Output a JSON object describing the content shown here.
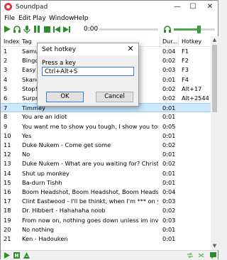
{
  "window": {
    "title": "Soundpad",
    "minimize_glyph": "—",
    "maximize_glyph": "☐",
    "close_glyph": "✕"
  },
  "menu": [
    "File",
    "Edit",
    "Play",
    "Window",
    "Help"
  ],
  "toolbar": {
    "time": "0:00",
    "volume_fraction": 0.6,
    "accent_color": "#2e8b2e"
  },
  "table": {
    "columns": [
      "Index",
      "Tag",
      "Dur...",
      "Hotkey"
    ],
    "rows": [
      {
        "index": "1",
        "tag": "Samu",
        "dur": "0:04",
        "hotkey": "F1"
      },
      {
        "index": "2",
        "tag": "Bingo",
        "dur": "0:02",
        "hotkey": "F2"
      },
      {
        "index": "3",
        "tag": "Easy s",
        "dur": "0:03",
        "hotkey": "F3"
      },
      {
        "index": "4",
        "tag": "Skand",
        "dur": "0:01",
        "hotkey": "F4"
      },
      {
        "index": "5",
        "tag": "Stop!",
        "dur": "0:02",
        "hotkey": "Alt+17"
      },
      {
        "index": "6",
        "tag": "Surpr",
        "dur": "0:02",
        "hotkey": "Alt+2544"
      },
      {
        "index": "7",
        "tag": "Timmey",
        "dur": "0:01",
        "hotkey": ""
      },
      {
        "index": "8",
        "tag": "You are an idiot",
        "dur": "0:01",
        "hotkey": ""
      },
      {
        "index": "9",
        "tag": "You want me to show you tough, I show you tough",
        "dur": "0:05",
        "hotkey": ""
      },
      {
        "index": "10",
        "tag": "Yes",
        "dur": "0:01",
        "hotkey": ""
      },
      {
        "index": "11",
        "tag": "Duke Nukem - Come get some",
        "dur": "0:02",
        "hotkey": ""
      },
      {
        "index": "12",
        "tag": "No",
        "dur": "0:01",
        "hotkey": ""
      },
      {
        "index": "13",
        "tag": "Duke Nukem - What are you waiting for? Christmas?",
        "dur": "0:02",
        "hotkey": ""
      },
      {
        "index": "14",
        "tag": "Shut up monkey",
        "dur": "0:01",
        "hotkey": ""
      },
      {
        "index": "15",
        "tag": "Ba-durn Tishh",
        "dur": "0:01",
        "hotkey": ""
      },
      {
        "index": "16",
        "tag": "Boom Headshot, Boom Headshot, Boom Headshot",
        "dur": "0:04",
        "hotkey": ""
      },
      {
        "index": "17",
        "tag": "Clint Eastwood - I'll be thinkt, when I'm *** on your grave",
        "dur": "0:03",
        "hotkey": ""
      },
      {
        "index": "18",
        "tag": "Dr. Hibbert - Hahahaha noob",
        "dur": "0:02",
        "hotkey": ""
      },
      {
        "index": "19",
        "tag": "From now on, nothing goes down unless im involved",
        "dur": "0:03",
        "hotkey": ""
      },
      {
        "index": "20",
        "tag": "No nothing",
        "dur": "0:01",
        "hotkey": ""
      },
      {
        "index": "21",
        "tag": "Ken - Hadouken",
        "dur": "0:01",
        "hotkey": ""
      }
    ],
    "selected_index": 6
  },
  "dialog": {
    "title": "Set hotkey",
    "close_glyph": "✕",
    "label": "Press a key",
    "value": "Ctrl+Alt+S",
    "ok_label": "OK",
    "cancel_label": "Cancel"
  }
}
